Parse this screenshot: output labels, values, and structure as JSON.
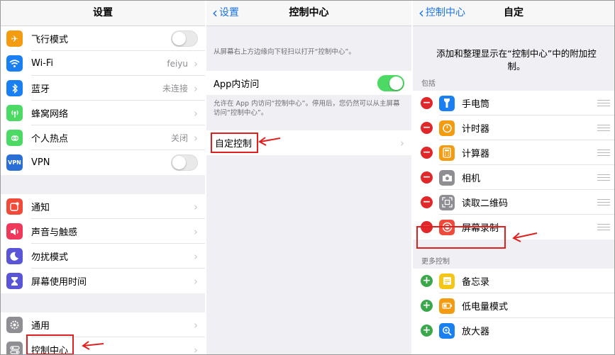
{
  "panel1": {
    "title": "设置",
    "group1": [
      {
        "label": "飞行模式",
        "type": "toggle",
        "on": false,
        "icon": "airplane-icon",
        "color": "#f39c12"
      },
      {
        "label": "Wi-Fi",
        "value": "feiyu",
        "icon": "wifi-icon",
        "color": "#1a7ff0"
      },
      {
        "label": "蓝牙",
        "value": "未连接",
        "icon": "bluetooth-icon",
        "color": "#1a7ff0"
      },
      {
        "label": "蜂窝网络",
        "icon": "cellular-icon",
        "color": "#4cd964"
      },
      {
        "label": "个人热点",
        "value": "关闭",
        "icon": "hotspot-icon",
        "color": "#4cd964"
      },
      {
        "label": "VPN",
        "type": "toggle",
        "on": false,
        "icon": "vpn-icon",
        "color": "#2a6fd6",
        "icon_text": "VPN"
      }
    ],
    "group2": [
      {
        "label": "通知",
        "icon": "notifications-icon",
        "color": "#f04a3a"
      },
      {
        "label": "声音与触感",
        "icon": "sound-icon",
        "color": "#f0395a"
      },
      {
        "label": "勿扰模式",
        "icon": "moon-icon",
        "color": "#5a55d6"
      },
      {
        "label": "屏幕使用时间",
        "icon": "hourglass-icon",
        "color": "#5a55d6"
      }
    ],
    "group3": [
      {
        "label": "通用",
        "icon": "gear-icon",
        "color": "#8e8e93"
      },
      {
        "label": "控制中心",
        "icon": "control-center-icon",
        "color": "#8e8e93"
      }
    ]
  },
  "panel2": {
    "back_label": "设置",
    "title": "控制中心",
    "intro": "从屏幕右上方边缘向下轻扫以打开“控制中心”。",
    "app_access_label": "App内访问",
    "app_access_on": true,
    "app_access_desc": "允许在 App 内访问“控制中心”。停用后，您仍然可以从主屏幕访问“控制中心”。",
    "customize_label": "自定控制"
  },
  "panel3": {
    "back_label": "控制中心",
    "title": "自定",
    "intro": "添加和整理显示在“控制中心”中的附加控制。",
    "included_header": "包括",
    "included": [
      {
        "label": "手电筒",
        "icon": "flashlight-icon",
        "color": "#1a7ff0"
      },
      {
        "label": "计时器",
        "icon": "timer-icon",
        "color": "#f39c12"
      },
      {
        "label": "计算器",
        "icon": "calculator-icon",
        "color": "#f39c12"
      },
      {
        "label": "相机",
        "icon": "camera-icon",
        "color": "#8e8e93"
      },
      {
        "label": "读取二维码",
        "icon": "qr-code-icon",
        "color": "#8e8e93"
      },
      {
        "label": "屏幕录制",
        "icon": "screen-record-icon",
        "color": "#f04a3a"
      }
    ],
    "more_header": "更多控制",
    "more": [
      {
        "label": "备忘录",
        "icon": "notes-icon",
        "color": "#f5c518"
      },
      {
        "label": "低电量模式",
        "icon": "battery-icon",
        "color": "#f39c12"
      },
      {
        "label": "放大器",
        "icon": "magnifier-icon",
        "color": "#1a7ff0"
      }
    ]
  },
  "highlight_color": "#e02020"
}
